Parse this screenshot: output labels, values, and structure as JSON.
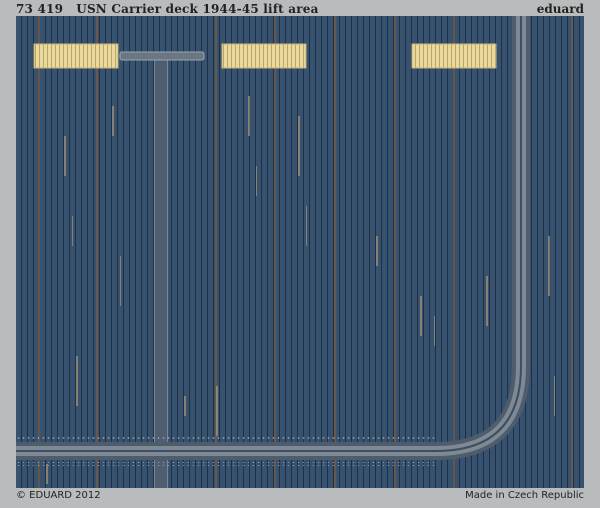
{
  "header": {
    "product_code": "73 419",
    "product_title": "USN Carrier deck 1944-45 lift area",
    "brand": "eduard"
  },
  "footer": {
    "copyright": "© EDUARD 2012",
    "made_in": "Made in Czech Republic"
  },
  "colors": {
    "sheet_bg": "#b9bcbc",
    "deck_blue": "#34506f",
    "plank_line": "#1e2e44",
    "rail": "#6b7784",
    "tan_panel": "#e8d79a",
    "seam": "#8a6a4a"
  }
}
